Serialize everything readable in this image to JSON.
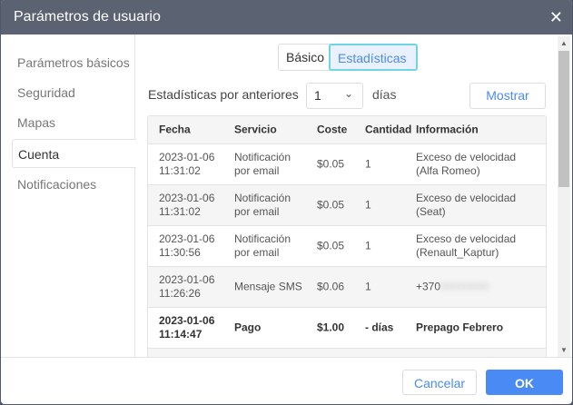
{
  "title": "Parámetros de usuario",
  "sidebar": {
    "items": [
      {
        "label": "Parámetros básicos"
      },
      {
        "label": "Seguridad"
      },
      {
        "label": "Mapas"
      },
      {
        "label": "Cuenta"
      },
      {
        "label": "Notificaciones"
      }
    ]
  },
  "tabs": {
    "basic": "Básico",
    "stats": "Estadísticas"
  },
  "filter": {
    "label": "Estadísticas por anteriores",
    "value": "1",
    "unit": "días",
    "show": "Mostrar"
  },
  "table": {
    "headers": [
      "Fecha",
      "Servicio",
      "Coste",
      "Cantidad",
      "Información"
    ],
    "rows": [
      {
        "date": "2023-01-06",
        "time": "11:31:02",
        "service1": "Notificación",
        "service2": "por email",
        "cost": "$0.05",
        "qty": "1",
        "info1": "Exceso de velocidad",
        "info2": "(Alfa Romeo)"
      },
      {
        "date": "2023-01-06",
        "time": "11:31:02",
        "service1": "Notificación",
        "service2": "por email",
        "cost": "$0.05",
        "qty": "1",
        "info1": "Exceso de velocidad",
        "info2": "(Seat)"
      },
      {
        "date": "2023-01-06",
        "time": "11:30:56",
        "service1": "Notificación",
        "service2": "por email",
        "cost": "$0.05",
        "qty": "1",
        "info1": "Exceso de velocidad",
        "info2": "(Renault_Kaptur)"
      },
      {
        "date": "2023-01-06",
        "time": "11:26:26",
        "service1": "Mensaje SMS",
        "service2": "",
        "cost": "$0.06",
        "qty": "1",
        "info1": "+370",
        "info2": "00000000"
      },
      {
        "date": "2023-01-06",
        "time": "11:14:47",
        "service1": "Pago",
        "service2": "",
        "cost": "$1.00",
        "qty": "- días",
        "info1": "Prepago Febrero",
        "info2": ""
      }
    ]
  },
  "footer": {
    "cancel": "Cancelar",
    "ok": "OK"
  }
}
